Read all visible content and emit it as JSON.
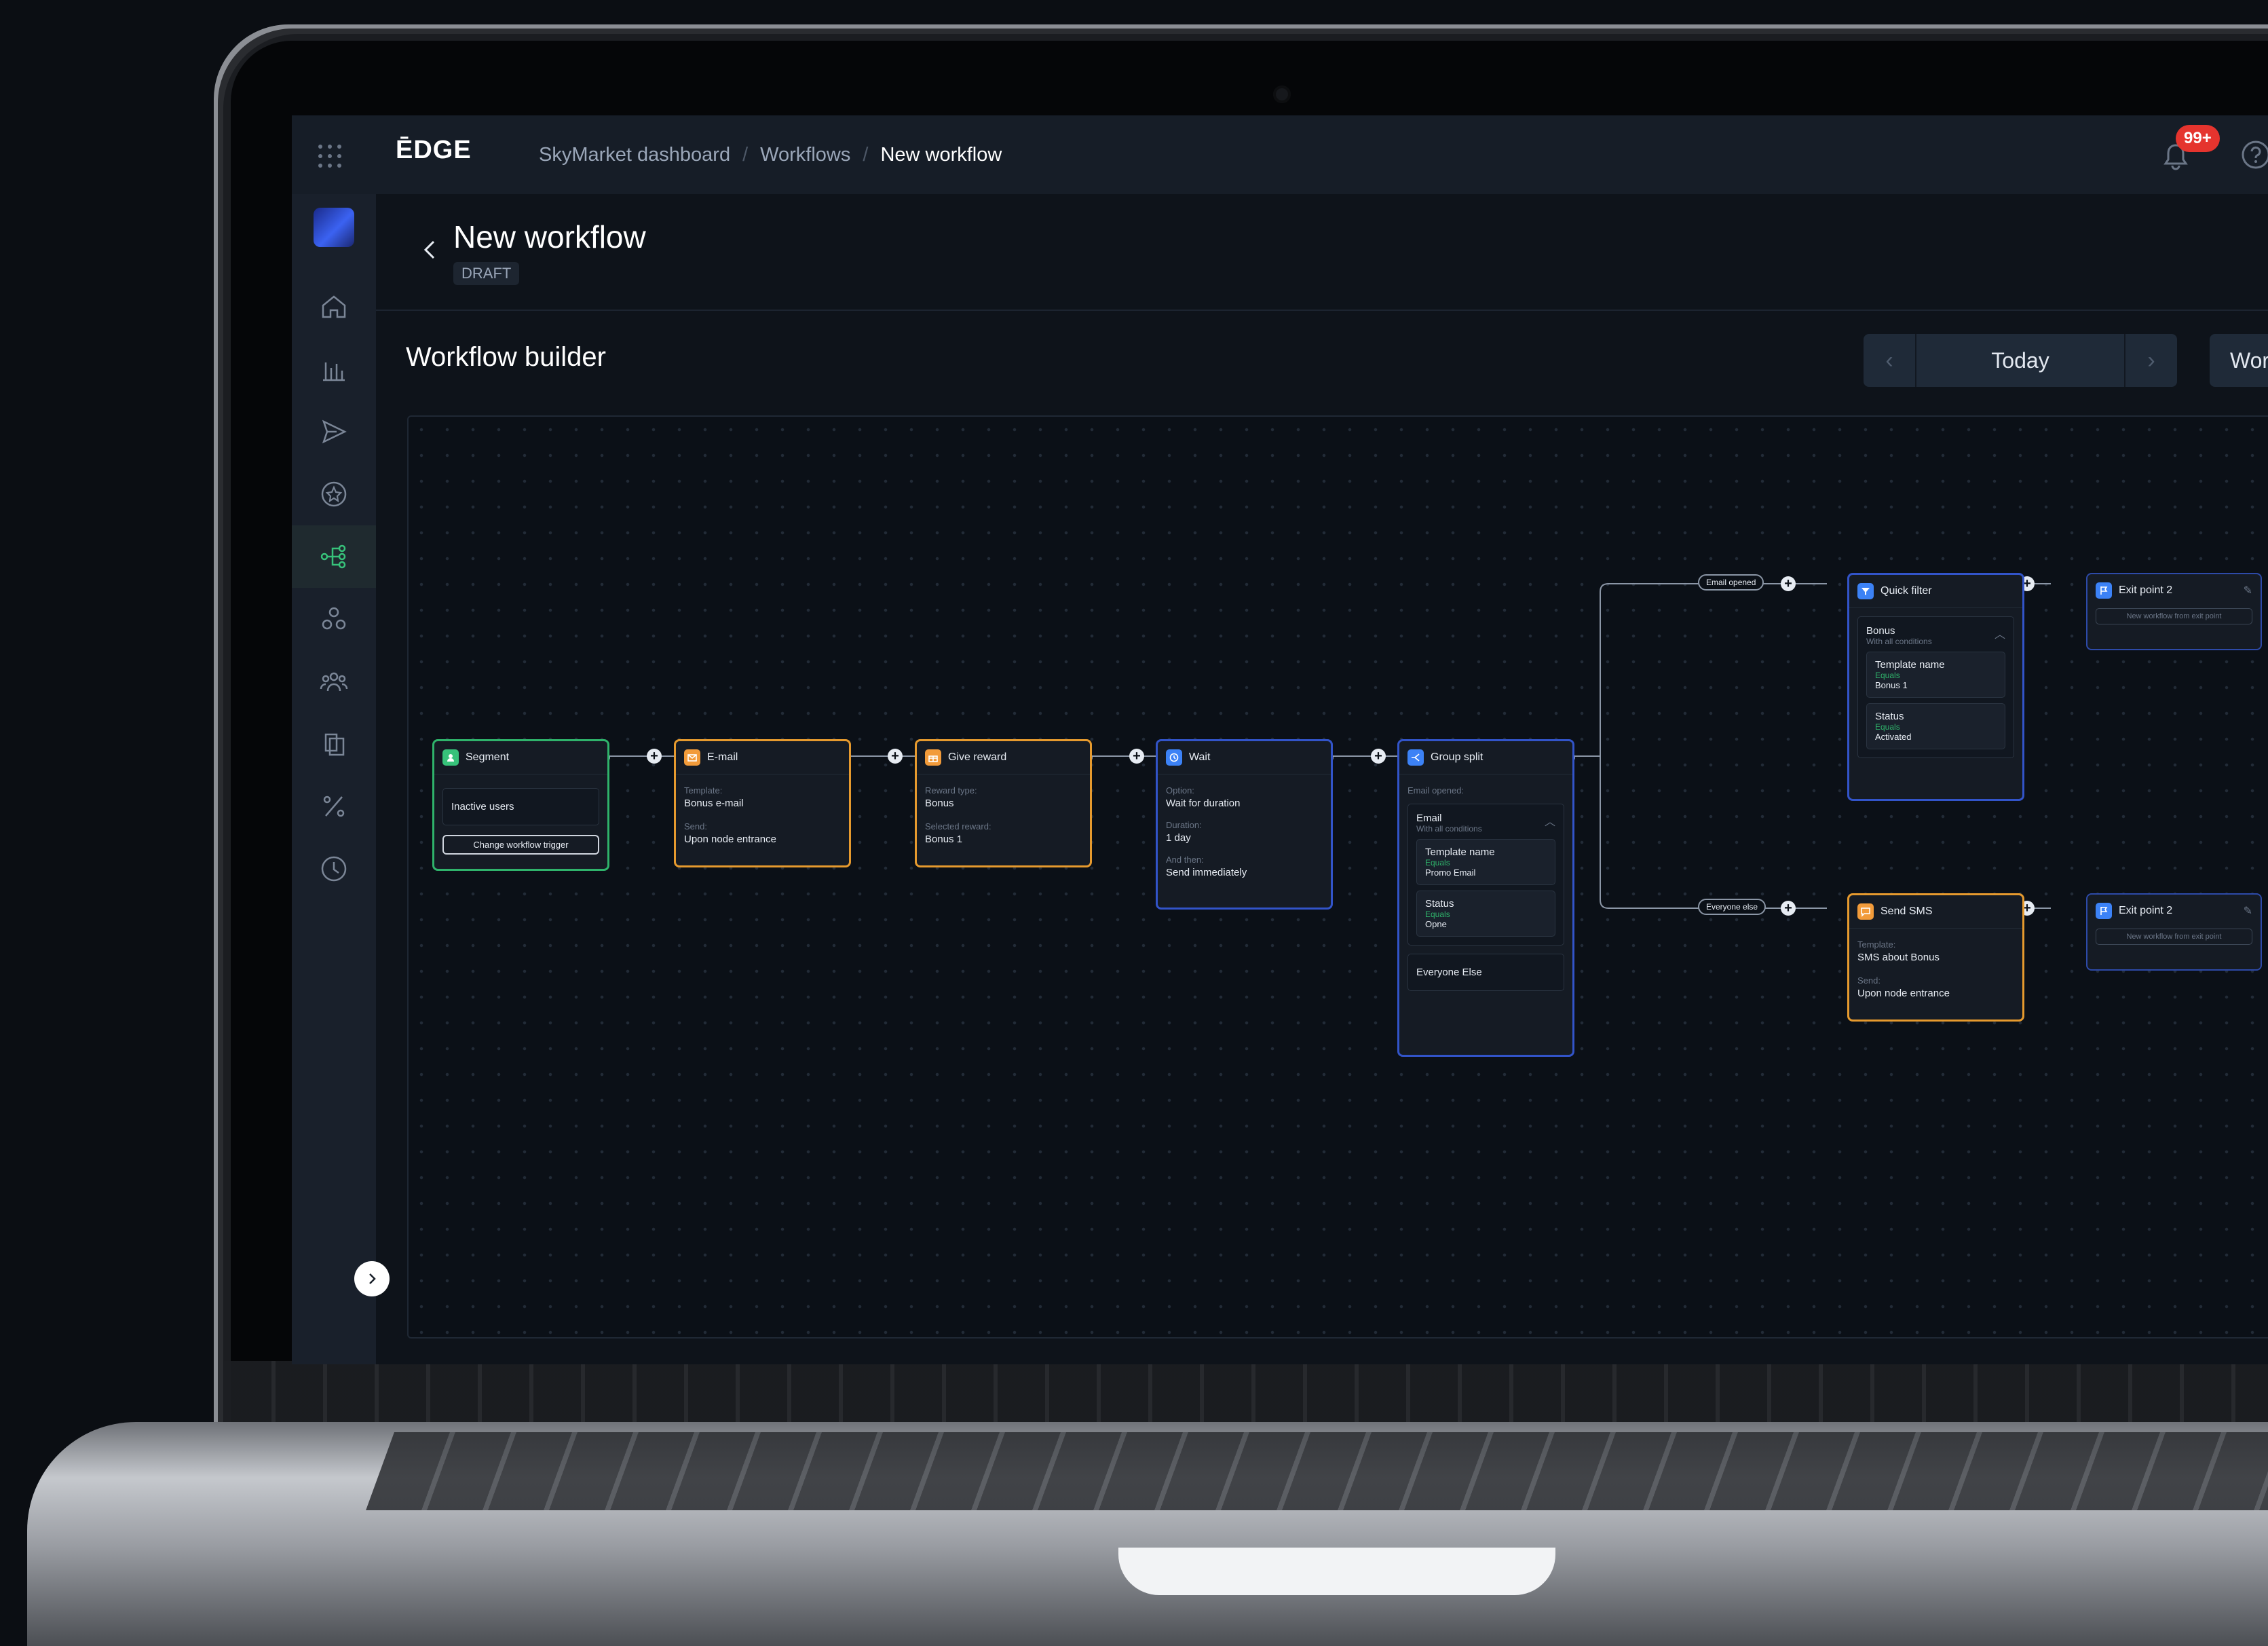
{
  "topbar": {
    "logo": "ĒDGE",
    "breadcrumb": [
      "SkyMarket dashboard",
      "Workflows",
      "New workflow"
    ],
    "separator": "/",
    "notification_count": "99+"
  },
  "header": {
    "title": "New workflow",
    "status": "DRAFT"
  },
  "builder": {
    "title": "Workflow builder",
    "date_label": "Today",
    "work_button": "Wor"
  },
  "nodes": {
    "segment": {
      "title": "Segment",
      "value": "Inactive users",
      "button": "Change workflow trigger"
    },
    "email": {
      "title": "E-mail",
      "template_label": "Template:",
      "template": "Bonus e-mail",
      "send_label": "Send:",
      "send": "Upon node entrance"
    },
    "reward": {
      "title": "Give reward",
      "type_label": "Reward type:",
      "type": "Bonus",
      "selected_label": "Selected reward:",
      "selected": "Bonus 1"
    },
    "wait": {
      "title": "Wait",
      "option_label": "Option:",
      "option": "Wait for duration",
      "duration_label": "Duration:",
      "duration": "1 day",
      "then_label": "And then:",
      "then": "Send immediately"
    },
    "group_split": {
      "title": "Group split",
      "section_label": "Email opened:",
      "group_name": "Email",
      "group_sub": "With all conditions",
      "cond1_name": "Template name",
      "cond1_op": "Equals",
      "cond1_value": "Promo Email",
      "cond2_name": "Status",
      "cond2_op": "Equals",
      "cond2_value": "Opne",
      "else": "Everyone Else"
    },
    "quick_filter": {
      "title": "Quick filter",
      "group_name": "Bonus",
      "group_sub": "With all conditions",
      "cond1_name": "Template name",
      "cond1_op": "Equals",
      "cond1_value": "Bonus 1",
      "cond2_name": "Status",
      "cond2_op": "Equals",
      "cond2_value": "Activated"
    },
    "send_sms": {
      "title": "Send SMS",
      "template_label": "Template:",
      "template": "SMS about Bonus",
      "send_label": "Send:",
      "send": "Upon node entrance"
    },
    "exit_top": {
      "title": "Exit point 2",
      "button": "New workflow from exit point"
    },
    "exit_bottom": {
      "title": "Exit point 2",
      "button": "New workflow from exit point"
    }
  },
  "edges": {
    "email_opened": "Email opened",
    "everyone_else": "Everyone else"
  },
  "colors": {
    "trigger": "#2fb36b",
    "action": "#e69a2e",
    "logic": "#3254c9",
    "accent": "#37c27a",
    "badge": "#e5342e"
  },
  "sidebar_icons": [
    "home-icon",
    "chart-icon",
    "send-icon",
    "star-badge-icon",
    "workflow-icon",
    "segments-icon",
    "users-icon",
    "documents-icon",
    "percent-icon",
    "clock-icon"
  ]
}
